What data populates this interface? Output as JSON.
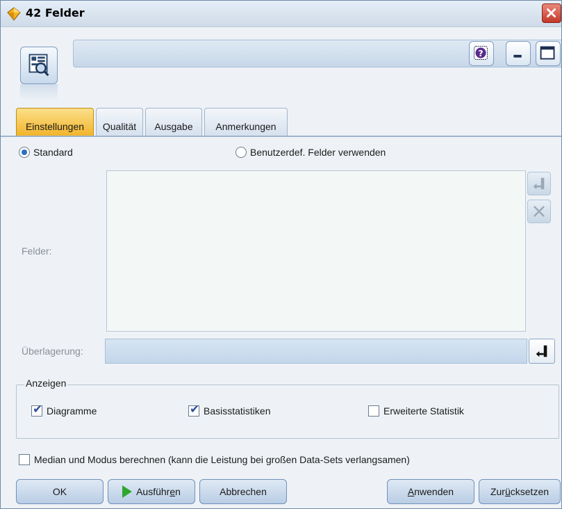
{
  "window": {
    "title": "42 Felder"
  },
  "tabs": [
    {
      "label": "Einstellungen",
      "active": true
    },
    {
      "label": "Qualität",
      "active": false
    },
    {
      "label": "Ausgabe",
      "active": false
    },
    {
      "label": "Anmerkungen",
      "active": false
    }
  ],
  "settings": {
    "radio_standard": "Standard",
    "radio_custom": "Benutzerdef. Felder verwenden",
    "selected": "Standard",
    "fields_label": "Felder:",
    "overlay_label": "Überlagerung:"
  },
  "display": {
    "group_title": "Anzeigen",
    "charts_label": "Diagramme",
    "charts_checked": true,
    "basic_stats_label": "Basisstatistiken",
    "basic_stats_checked": true,
    "advanced_stats_label": "Erweiterte Statistik",
    "advanced_stats_checked": false
  },
  "median": {
    "label": "Median und Modus berechnen (kann die Leistung bei großen Data-Sets verlangsamen)",
    "checked": false
  },
  "buttons": {
    "ok": "OK",
    "run_pre": "Ausführ",
    "run_u": "e",
    "run_post": "n",
    "cancel": "Abbrechen",
    "apply_u": "A",
    "apply_post": "nwenden",
    "reset_pre": "Zur",
    "reset_u": "ü",
    "reset_post": "cksetzen"
  },
  "colors": {
    "active_tab": "#f2b42c",
    "close_button": "#c5382a",
    "run_icon": "#2fa72f"
  },
  "icons": [
    "node-diamond-icon",
    "close-icon",
    "data-audit-node-icon",
    "help-icon",
    "minimize-icon",
    "maximize-icon",
    "field-picker-icon",
    "delete-icon",
    "play-icon"
  ]
}
